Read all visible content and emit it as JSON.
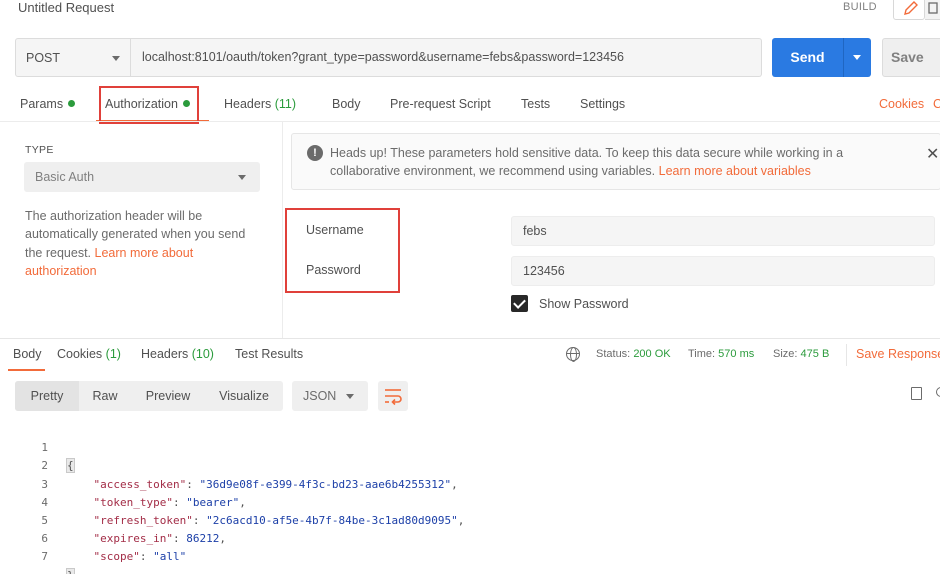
{
  "request": {
    "title": "Untitled Request",
    "build_label": "BUILD",
    "method": "POST",
    "url": "localhost:8101/oauth/token?grant_type=password&username=febs&password=123456",
    "send_label": "Send",
    "save_label": "Save"
  },
  "tabs": [
    {
      "label": "Params",
      "count": "",
      "dot": true
    },
    {
      "label": "Authorization",
      "count": "",
      "dot": true,
      "active": true
    },
    {
      "label": "Headers",
      "count": "(11)"
    },
    {
      "label": "Body",
      "count": ""
    },
    {
      "label": "Pre-request Script",
      "count": ""
    },
    {
      "label": "Tests",
      "count": ""
    },
    {
      "label": "Settings",
      "count": ""
    }
  ],
  "tab_links": {
    "cookies": "Cookies",
    "code": "C"
  },
  "auth": {
    "type_heading": "TYPE",
    "type_value": "Basic Auth",
    "description": "The authorization header will be automatically generated when you send the request.",
    "learn_more": "Learn more about authorization",
    "notice_text": "Heads up! These parameters hold sensitive data. To keep this data secure while working in a collaborative environment, we recommend using variables.",
    "notice_link": "Learn more about variables",
    "username_label": "Username",
    "username_value": "febs",
    "password_label": "Password",
    "password_value": "123456",
    "show_password_label": "Show Password",
    "show_password_checked": true
  },
  "response": {
    "tabs": [
      {
        "label": "Body",
        "count": ""
      },
      {
        "label": "Cookies",
        "count": "(1)"
      },
      {
        "label": "Headers",
        "count": "(10)"
      },
      {
        "label": "Test Results",
        "count": ""
      }
    ],
    "status_label": "Status:",
    "status_value": "200 OK",
    "time_label": "Time:",
    "time_value": "570 ms",
    "size_label": "Size:",
    "size_value": "475 B",
    "save_response": "Save Response",
    "views": [
      "Pretty",
      "Raw",
      "Preview",
      "Visualize"
    ],
    "format": "JSON",
    "code_lines": [
      {
        "n": "1",
        "text": "{"
      },
      {
        "n": "2",
        "key": "\"access_token\"",
        "val": "\"36d9e08f-e399-4f3c-bd23-aae6b4255312\"",
        "tail": ","
      },
      {
        "n": "3",
        "key": "\"token_type\"",
        "val": "\"bearer\"",
        "tail": ","
      },
      {
        "n": "4",
        "key": "\"refresh_token\"",
        "val": "\"2c6acd10-af5e-4b7f-84be-3c1ad80d9095\"",
        "tail": ","
      },
      {
        "n": "5",
        "key": "\"expires_in\"",
        "val": "86212",
        "tail": ","
      },
      {
        "n": "6",
        "key": "\"scope\"",
        "val": "\"all\"",
        "tail": ""
      },
      {
        "n": "7",
        "text": "}"
      }
    ]
  },
  "colors": {
    "accent": "#f26b3a",
    "primary": "#2a7ae2",
    "success": "#2b9b3c",
    "highlight_box": "#e0403a"
  },
  "icons": [
    "edit-icon",
    "document-icon",
    "caret-down-icon",
    "warning-icon",
    "close-icon",
    "checkbox-checked-icon",
    "globe-icon",
    "wrap-lines-icon",
    "copy-icon",
    "search-icon"
  ]
}
